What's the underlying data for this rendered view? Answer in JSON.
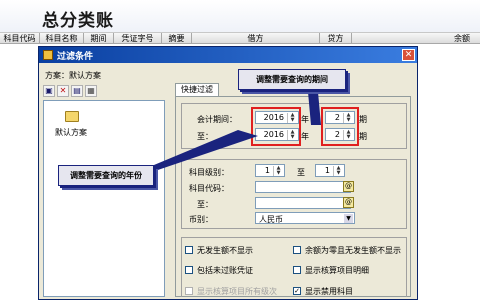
{
  "ledger": {
    "title": "总分类账",
    "columns": [
      "科目代码",
      "科目名称",
      "期间",
      "凭证字号",
      "摘要",
      "借方",
      "贷方",
      "余额"
    ]
  },
  "dialog": {
    "title": "过滤条件",
    "close_label": "✕",
    "scheme_label": "方案：默认方案",
    "scheme_item": "默认方案",
    "tab_quick": "快捷过滤",
    "period_label": "会计期间：",
    "to_label": "至：",
    "year_from": "2016",
    "year_to": "2016",
    "year_unit": "年",
    "period_from": "2",
    "period_to": "2",
    "period_unit": "期",
    "level_label": "科目级别：",
    "level_from": "1",
    "level_to": "1",
    "level_sep": "至",
    "code_label": "科目代码：",
    "code_to_label": "至：",
    "currency_label": "币别：",
    "currency_value": "人民币",
    "options": [
      {
        "label": "无发生额不显示",
        "checked": false,
        "disabled": false
      },
      {
        "label": "余额为零且无发生额不显示",
        "checked": false,
        "disabled": false
      },
      {
        "label": "包括未过账凭证",
        "checked": false,
        "disabled": false
      },
      {
        "label": "显示核算项目明细",
        "checked": false,
        "disabled": false
      },
      {
        "label": "显示核算项目所有级次",
        "checked": false,
        "disabled": true
      },
      {
        "label": "显示禁用科目",
        "checked": true,
        "disabled": false
      }
    ]
  },
  "annotations": {
    "period_note": "调整需要查询的期间",
    "year_note": "调整需要查询的年份"
  },
  "colors": {
    "title_bar": "#0a3fa0",
    "dialog_bg": "#ece9d8",
    "highlight_box": "#e02020",
    "callout_border": "#1a237e"
  }
}
